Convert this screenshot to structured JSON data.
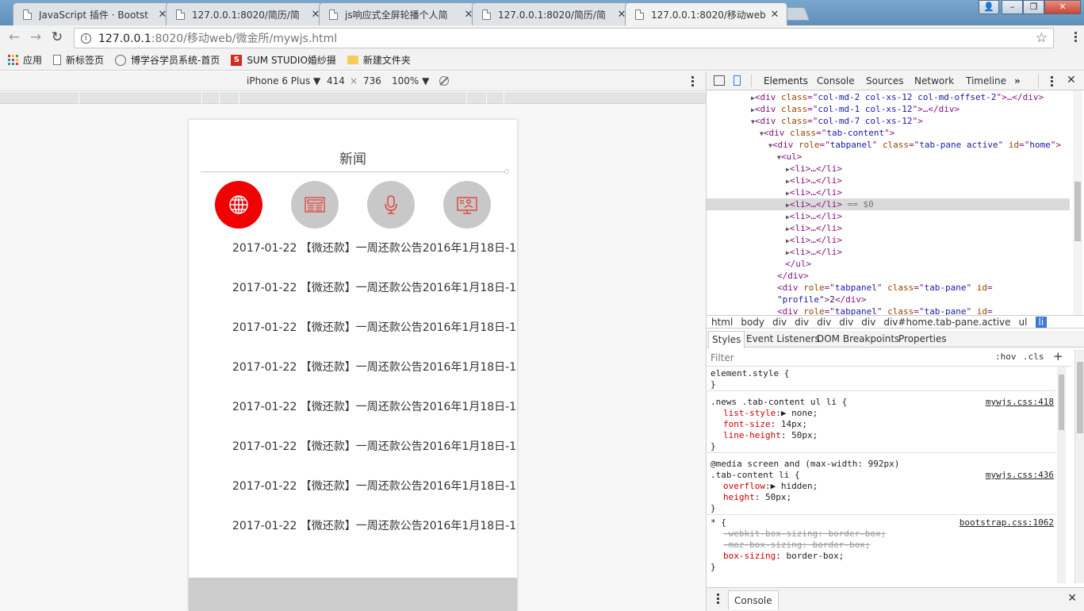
{
  "browser": {
    "tabs": [
      {
        "title": "JavaScript 插件 · Bootst"
      },
      {
        "title": "127.0.0.1:8020/简历/简"
      },
      {
        "title": "js响应式全屏轮播个人简"
      },
      {
        "title": "127.0.0.1:8020/简历/简"
      },
      {
        "title": "127.0.0.1:8020/移动web"
      }
    ],
    "url_host": "127.0.0.1",
    "url_path": ":8020/移动web/微金所/mywjs.html",
    "bookmarks": [
      {
        "label": "应用"
      },
      {
        "label": "新标签页"
      },
      {
        "label": "博学谷学员系统-首页"
      },
      {
        "label": "SUM STUDIO婚纱摄"
      },
      {
        "label": "新建文件夹"
      }
    ]
  },
  "device_toolbar": {
    "device": "iPhone 6 Plus",
    "width": "414",
    "times": "×",
    "height": "736",
    "zoom": "100%"
  },
  "page": {
    "section_title": "新闻",
    "icons": [
      "globe-icon",
      "newspaper-icon",
      "microphone-icon",
      "presentation-icon"
    ],
    "active_icon_index": 0,
    "news_items": [
      "2017-01-22 【微还款】一周还款公告2016年1月18日-1",
      "2017-01-22 【微还款】一周还款公告2016年1月18日-1",
      "2017-01-22 【微还款】一周还款公告2016年1月18日-1",
      "2017-01-22 【微还款】一周还款公告2016年1月18日-1",
      "2017-01-22 【微还款】一周还款公告2016年1月18日-1",
      "2017-01-22 【微还款】一周还款公告2016年1月18日-1",
      "2017-01-22 【微还款】一周还款公告2016年1月18日-1",
      "2017-01-22 【微还款】一周还款公告2016年1月18日-1"
    ],
    "colors": {
      "accent": "#f00000",
      "inactive_circle": "#c8c8c8",
      "footer": "#cccccc"
    }
  },
  "devtools": {
    "tabs": [
      "Elements",
      "Console",
      "Sources",
      "Network",
      "Timeline"
    ],
    "more": "»",
    "elements": {
      "div1": {
        "cls": "col-md-2 col-xs-12 col-md-offset-2",
        "tail": ">…</"
      },
      "div2": {
        "cls": "col-md-1 col-xs-12",
        "tail": ">…</"
      },
      "div3": {
        "cls": "col-md-7 col-xs-12"
      },
      "div4": {
        "cls": "tab-content"
      },
      "div5": {
        "role": "tabpanel",
        "cls": "tab-pane active",
        "id": "home"
      },
      "li_text": "<li>…</li>",
      "selected_suffix": "== $0",
      "ul_close": "</ul>",
      "div_close": "</div>",
      "profile_id": "profile",
      "profile_content": "2",
      "tabpanel": "tabpanel",
      "tab_pane": "tab-pane"
    },
    "breadcrumbs": [
      "html",
      "body",
      "div",
      "div",
      "div",
      "div",
      "div",
      "div#home.tab-pane.active",
      "ul",
      "li"
    ],
    "sub_tabs": [
      "Styles",
      "Event Listeners",
      "DOM Breakpoints",
      "Properties"
    ],
    "filter_placeholder": "Filter",
    "hov": ":hov",
    "cls": ".cls",
    "plus": "+",
    "styles": {
      "element_style": "element.style {",
      "close": "}",
      "rule1_selector": ".news .tab-content ul li {",
      "rule1_src": "mywjs.css:418",
      "rule1_decls": [
        {
          "prop": "list-style",
          "sep": ":▶",
          "value": " none;"
        },
        {
          "prop": "font-size",
          "sep": ":",
          "value": " 14px;"
        },
        {
          "prop": "line-height",
          "sep": ":",
          "value": " 50px;"
        }
      ],
      "rule2_media": "@media screen and (max-width: 992px)",
      "rule2_selector": ".tab-content li {",
      "rule2_src": "mywjs.css:436",
      "rule2_decls": [
        {
          "prop": "overflow",
          "sep": ":▶",
          "value": " hidden;"
        },
        {
          "prop": "height",
          "sep": ":",
          "value": " 50px;"
        }
      ],
      "rule3_selector": "* {",
      "rule3_src": "bootstrap.css:1062",
      "rule3_struck": [
        "-webkit-box-sizing: border-box;",
        "-moz-box-sizing: border-box;"
      ],
      "rule3_decl": {
        "prop": "box-sizing",
        "sep": ":",
        "value": " border-box;"
      }
    },
    "drawer_tab": "Console"
  }
}
